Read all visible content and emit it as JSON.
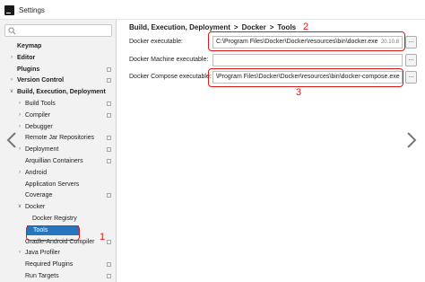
{
  "window": {
    "title": "Settings"
  },
  "sidebar": {
    "items": [
      {
        "label": "Keymap",
        "bold": true,
        "arrow": "",
        "level": 0,
        "cfg": false
      },
      {
        "label": "Editor",
        "bold": true,
        "arrow": ">",
        "level": 0,
        "cfg": false
      },
      {
        "label": "Plugins",
        "bold": true,
        "arrow": "",
        "level": 0,
        "cfg": true
      },
      {
        "label": "Version Control",
        "bold": true,
        "arrow": ">",
        "level": 0,
        "cfg": true
      },
      {
        "label": "Build, Execution, Deployment",
        "bold": true,
        "arrow": "v",
        "level": 0,
        "cfg": false
      },
      {
        "label": "Build Tools",
        "bold": false,
        "arrow": ">",
        "level": 1,
        "cfg": true
      },
      {
        "label": "Compiler",
        "bold": false,
        "arrow": ">",
        "level": 1,
        "cfg": true
      },
      {
        "label": "Debugger",
        "bold": false,
        "arrow": ">",
        "level": 1,
        "cfg": false
      },
      {
        "label": "Remote Jar Repositories",
        "bold": false,
        "arrow": "",
        "level": 1,
        "cfg": true
      },
      {
        "label": "Deployment",
        "bold": false,
        "arrow": ">",
        "level": 1,
        "cfg": true
      },
      {
        "label": "Arquillian Containers",
        "bold": false,
        "arrow": "",
        "level": 1,
        "cfg": true
      },
      {
        "label": "Android",
        "bold": false,
        "arrow": ">",
        "level": 1,
        "cfg": false
      },
      {
        "label": "Application Servers",
        "bold": false,
        "arrow": "",
        "level": 1,
        "cfg": false
      },
      {
        "label": "Coverage",
        "bold": false,
        "arrow": "",
        "level": 1,
        "cfg": true
      },
      {
        "label": "Docker",
        "bold": false,
        "arrow": "v",
        "level": 1,
        "cfg": false
      },
      {
        "label": "Docker Registry",
        "bold": false,
        "arrow": "",
        "level": 2,
        "cfg": false
      },
      {
        "label": "Tools",
        "bold": false,
        "arrow": "",
        "level": 2,
        "cfg": false,
        "selected": true
      },
      {
        "label": "Gradle-Android Compiler",
        "bold": false,
        "arrow": "",
        "level": 1,
        "cfg": true
      },
      {
        "label": "Java Profiler",
        "bold": false,
        "arrow": ">",
        "level": 1,
        "cfg": false
      },
      {
        "label": "Required Plugins",
        "bold": false,
        "arrow": "",
        "level": 1,
        "cfg": true
      },
      {
        "label": "Run Targets",
        "bold": false,
        "arrow": "",
        "level": 1,
        "cfg": true
      }
    ]
  },
  "breadcrumb": {
    "part1": "Build, Execution, Deployment",
    "sep1": ">",
    "part2": "Docker",
    "sep2": ">",
    "part3": "Tools"
  },
  "fields": {
    "docker_exe": {
      "label": "Docker executable:",
      "value": "C:\\Program Files\\Docker\\Docker\\resources\\bin\\docker.exe",
      "version": "20.10.8"
    },
    "machine_exe": {
      "label": "Docker Machine executable:",
      "value": ""
    },
    "compose_exe": {
      "label": "Docker Compose executable:",
      "value": "\\Program Files\\Docker\\Docker\\resources\\bin\\docker-compose.exe"
    },
    "browse_label": "..."
  },
  "annotations": {
    "one": "1",
    "two": "2",
    "three": "3",
    "color": "#e01818"
  },
  "accent": {
    "selection": "#2675bf"
  },
  "icons": {
    "search": "search-icon",
    "prev": "chevron-left-icon",
    "next": "chevron-right-icon"
  }
}
